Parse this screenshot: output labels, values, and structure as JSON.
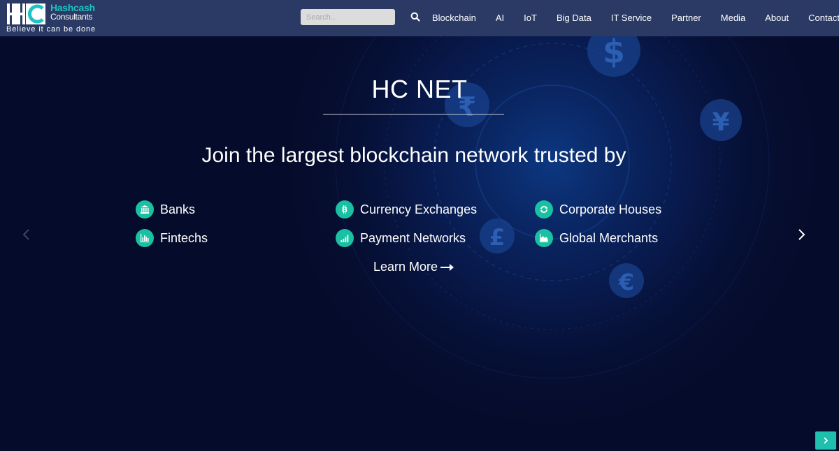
{
  "header": {
    "logo": {
      "brand": "Hashcash",
      "sub": "Consultants",
      "tagline": "Believe it can be done"
    },
    "search": {
      "placeholder": "Search..."
    },
    "nav": [
      {
        "label": "Blockchain"
      },
      {
        "label": "AI"
      },
      {
        "label": "IoT"
      },
      {
        "label": "Big Data"
      },
      {
        "label": "IT Service"
      },
      {
        "label": "Partner"
      },
      {
        "label": "Media"
      },
      {
        "label": "About"
      },
      {
        "label": "Contact"
      }
    ]
  },
  "hero": {
    "title": "HC NET",
    "subtitle": "Join the largest blockchain network trusted by",
    "features": [
      {
        "label": "Banks",
        "icon": "bank-icon"
      },
      {
        "label": "Currency Exchanges",
        "icon": "bitcoin-icon"
      },
      {
        "label": "Corporate Houses",
        "icon": "refresh-icon"
      },
      {
        "label": "Fintechs",
        "icon": "bar-chart-icon"
      },
      {
        "label": "Payment Networks",
        "icon": "signal-icon"
      },
      {
        "label": "Global Merchants",
        "icon": "area-chart-icon"
      }
    ],
    "learn_more": "Learn More",
    "background_symbols": [
      "$",
      "₹",
      "¥",
      "£",
      "€"
    ]
  },
  "colors": {
    "header_bg": "#2a3a64",
    "hero_bg": "#050b2a",
    "accent": "#19c1a2",
    "brand": "#1ec3c3"
  }
}
